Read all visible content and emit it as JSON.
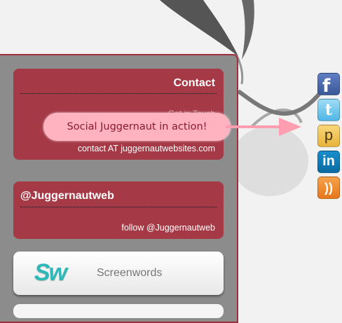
{
  "contact": {
    "title": "Contact",
    "muted_line": "Get in Touch",
    "email": "contact AT juggernautwebsites.com"
  },
  "twitter": {
    "handle": "@Juggernautweb",
    "follow": "follow @Juggernautweb"
  },
  "screenwords": {
    "logo": "Sw",
    "label": "Screenwords"
  },
  "callout": {
    "text": "Social Juggernaut in action!"
  },
  "social": [
    {
      "icon": "facebook-icon",
      "glyph": "f"
    },
    {
      "icon": "twitter-icon",
      "glyph": "t"
    },
    {
      "icon": "pinterest-icon",
      "glyph": "p"
    },
    {
      "icon": "linkedin-icon",
      "glyph": "in"
    },
    {
      "icon": "rss-icon",
      "glyph": "))"
    }
  ],
  "colors": {
    "panel_border": "#a02f3d",
    "box_fill": "#a82d3c",
    "callout_fill": "#ffb3c1",
    "callout_text": "#8a1a2c"
  }
}
